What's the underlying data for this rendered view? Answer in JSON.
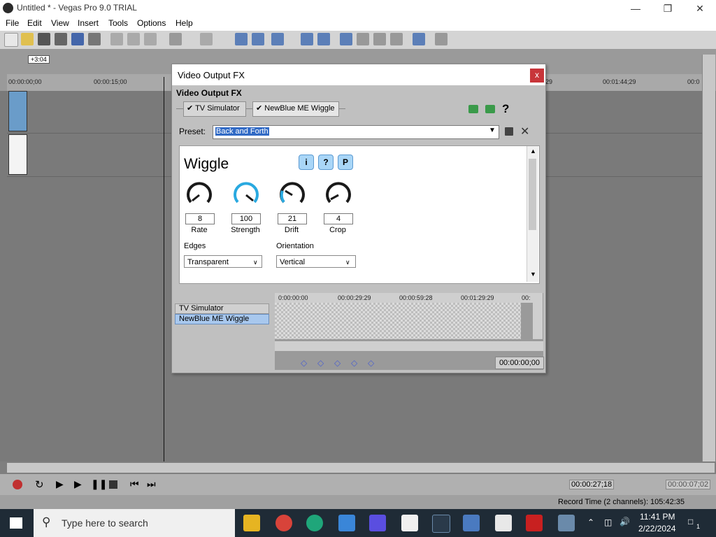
{
  "window": {
    "title": "Untitled * - Vegas Pro 9.0 TRIAL"
  },
  "menu": [
    "File",
    "Edit",
    "View",
    "Insert",
    "Tools",
    "Options",
    "Help"
  ],
  "timeline": {
    "cursor_offset": "+3:04",
    "ruler": [
      "00:00:00;00",
      "00:00:15;00",
      "29",
      "00:01:44;29",
      "00:0"
    ]
  },
  "dialog": {
    "title": "Video Output FX",
    "close": "x",
    "subtitle": "Video Output FX",
    "chain": [
      "TV Simulator",
      "NewBlue ME Wiggle"
    ],
    "preset_label": "Preset:",
    "preset_value": "Back and Forth",
    "plugin": {
      "name": "Wiggle",
      "badges": [
        "i",
        "?",
        "P"
      ],
      "knobs": [
        {
          "label": "Rate",
          "value": "8"
        },
        {
          "label": "Strength",
          "value": "100"
        },
        {
          "label": "Drift",
          "value": "21"
        },
        {
          "label": "Crop",
          "value": "4"
        }
      ],
      "edges_label": "Edges",
      "edges_value": "Transparent",
      "orientation_label": "Orientation",
      "orientation_value": "Vertical"
    },
    "keyframe": {
      "tracks": [
        "TV Simulator",
        "NewBlue ME Wiggle"
      ],
      "ruler": [
        "0:00:00:00",
        "00:00:29:29",
        "00:00:59:28",
        "00:01:29:29",
        "00:"
      ],
      "time": "00:00:00;00"
    }
  },
  "transport": {
    "time1": "00:00:27;18",
    "time2": "00:00:07;02"
  },
  "status": {
    "record_time": "Record Time (2 channels): 105:42:35"
  },
  "taskbar": {
    "search_placeholder": "Type here to search",
    "time": "11:41 PM",
    "date": "2/22/2024",
    "notifications": "1"
  },
  "colors": {
    "accent": "#316ac5",
    "close": "#c8353a",
    "knob": "#1a1a1a",
    "knob_active": "#29a9e0"
  }
}
